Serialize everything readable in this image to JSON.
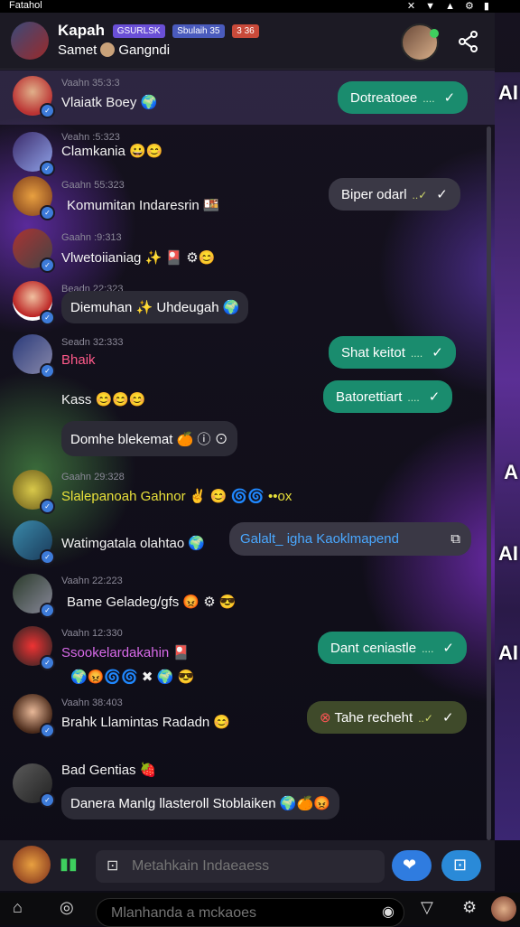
{
  "status_bar": {
    "title": "Fatahol",
    "icons": "✕ ▼ ▲ ⚙ ▮"
  },
  "header": {
    "title": "Kapah",
    "badges": [
      "GSURLSK",
      "Sbulaih 35",
      "3 36"
    ],
    "subtitle_prefix": "Samet",
    "subtitle": "Gangndi",
    "share_icon": "share-icon"
  },
  "messages": [
    {
      "time": "Vaahn 35:3:3",
      "name": "Vlaiatk Boey 🌍",
      "reply": "Dotreatoee",
      "reply_style": "green"
    },
    {
      "time": "Veahn :5:323",
      "name": "Clamkania 😀😊"
    },
    {
      "time": "Gaahn 55:323",
      "name": "Komumitan Indaresrin 🍱",
      "reply": "Biper odarl",
      "reply_style": "grey"
    },
    {
      "time": "Gaahn :9:313",
      "name": "Vlwetoiianiag ✨ 🎴 ⚙😊"
    },
    {
      "time": "Beadn 22:323",
      "name": "Diemuhan ✨ Uhdeugah 🌍"
    },
    {
      "time": "Seadn 32:333",
      "name": "Bhaik",
      "reply": "Shat keitot",
      "reply_style": "green"
    },
    {
      "time": "",
      "name": "Kass 😊😊😊",
      "reply": "Batorettiart",
      "reply_style": "green"
    },
    {
      "time": "",
      "name": "Domhe blekemat 🍊 ⓘ ⊙"
    },
    {
      "time": "Gaahn 29:328",
      "name": "Slalepanoah Gahnor ✌ 😊 🌀🌀 ••ox"
    },
    {
      "time": "",
      "name": "Watimgatala olahtao 🌍",
      "reply": "Galalt_ igha Kaoklmapend",
      "reply_style": "card"
    },
    {
      "time": "Vaahn 22:223",
      "name": "Bame Geladeg/gfs 😡 ⚙ 😎"
    },
    {
      "time": "Vaahn 12:330",
      "name": "Ssookelardakahin 🎴",
      "reply": "Dant ceniastle",
      "reply_style": "green"
    },
    {
      "time": "",
      "name": "🌍😡🌀🌀 ✖ 🌍 😎"
    },
    {
      "time": "Vaahn 38:403",
      "name": "Brahk Llamintas Radadn 😊",
      "reply": "Tahe recheht",
      "reply_style": "olive"
    },
    {
      "time": "",
      "name": "Bad Gentias 🍓"
    },
    {
      "time": "",
      "name": "Danera Manlg llasteroll Stoblaiken 🌍🍊😡"
    }
  ],
  "input": {
    "placeholder": "Metahkain Indaeaess"
  },
  "bottom_search": {
    "placeholder": "Mlanhanda a mckaoes"
  }
}
